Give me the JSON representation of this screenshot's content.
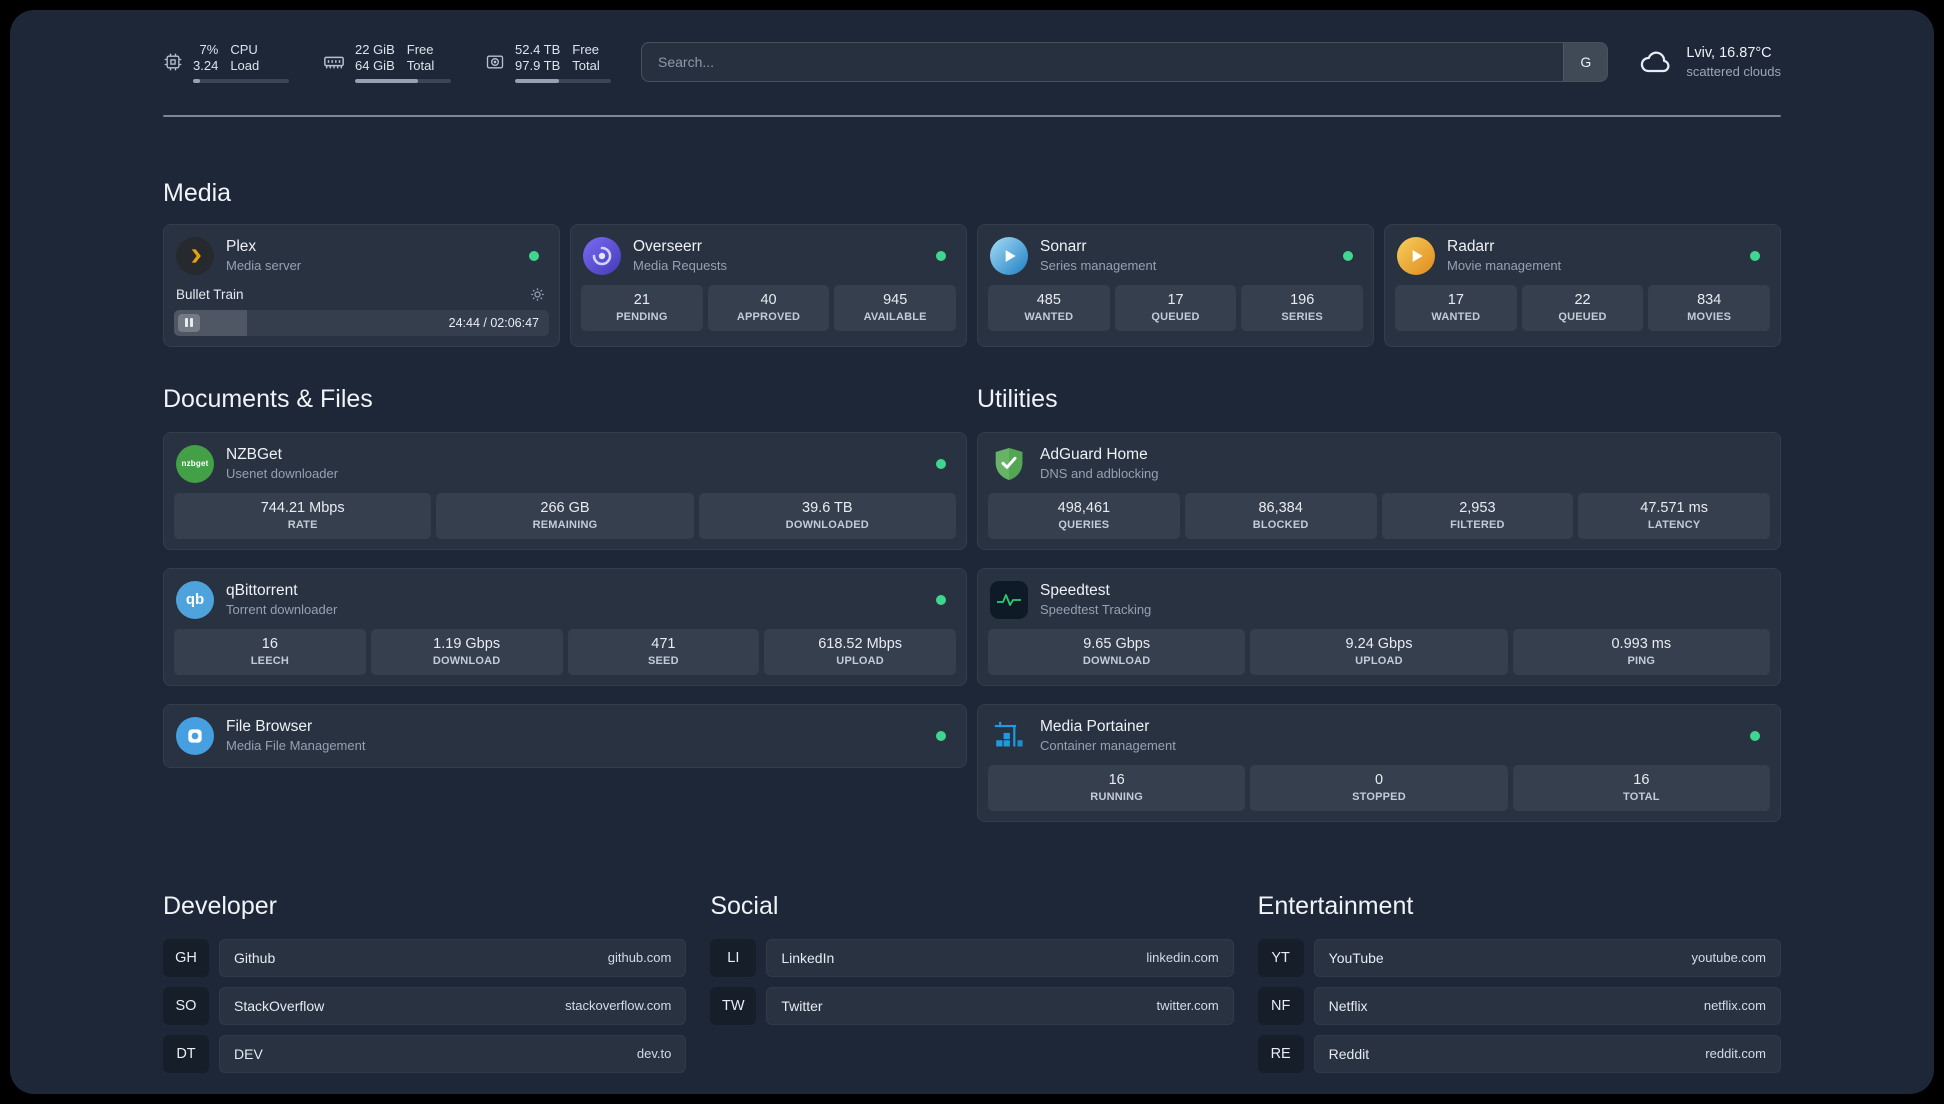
{
  "colors": {
    "page_bg": "#1d2737",
    "status_online": "#3fd68f",
    "plex_amber": "#e5a00d",
    "adguard_green": "#67b367",
    "speedtest_green": "#2ecc71",
    "portainer_blue": "#1f9ce0",
    "nzbget_green": "#43a047",
    "qbittorrent_blue": "#4fa3dc"
  },
  "icons": {
    "topbar": [
      "cpu-icon",
      "memory-icon",
      "disk-icon"
    ],
    "weather": "cloud-icon",
    "search_provider": "google-button",
    "plex_row": [
      "pause-icon",
      "gear-icon"
    ],
    "status": "online-dot"
  },
  "topbar": {
    "resources": [
      {
        "rows": [
          {
            "value": "7%",
            "label": "CPU"
          },
          {
            "value": "3.24",
            "label": "Load"
          }
        ],
        "used_percent": 7
      },
      {
        "rows": [
          {
            "value": "22 GiB",
            "label": "Free"
          },
          {
            "value": "64 GiB",
            "label": "Total"
          }
        ],
        "used_percent": 66
      },
      {
        "rows": [
          {
            "value": "52.4 TB",
            "label": "Free"
          },
          {
            "value": "97.9 TB",
            "label": "Total"
          }
        ],
        "used_percent": 46
      }
    ],
    "search": {
      "placeholder": "Search...",
      "provider_button": "G"
    },
    "weather": {
      "location": "Lviv, 16.87°C",
      "condition": "scattered clouds"
    }
  },
  "sections": {
    "media": {
      "title": "Media"
    },
    "documents": {
      "title": "Documents & Files"
    },
    "utilities": {
      "title": "Utilities"
    }
  },
  "services": {
    "plex": {
      "name": "Plex",
      "desc": "Media server",
      "now_playing": {
        "title": "Bullet Train",
        "time": "24:44 / 02:06:47",
        "progress_percent": 19.5
      }
    },
    "overseerr": {
      "name": "Overseerr",
      "desc": "Media Requests",
      "stats": [
        {
          "value": "21",
          "label": "PENDING"
        },
        {
          "value": "40",
          "label": "APPROVED"
        },
        {
          "value": "945",
          "label": "AVAILABLE"
        }
      ]
    },
    "sonarr": {
      "name": "Sonarr",
      "desc": "Series management",
      "stats": [
        {
          "value": "485",
          "label": "WANTED"
        },
        {
          "value": "17",
          "label": "QUEUED"
        },
        {
          "value": "196",
          "label": "SERIES"
        }
      ]
    },
    "radarr": {
      "name": "Radarr",
      "desc": "Movie management",
      "stats": [
        {
          "value": "17",
          "label": "WANTED"
        },
        {
          "value": "22",
          "label": "QUEUED"
        },
        {
          "value": "834",
          "label": "MOVIES"
        }
      ]
    },
    "nzbget": {
      "name": "NZBGet",
      "desc": "Usenet downloader",
      "icon_text": "nzbget",
      "stats": [
        {
          "value": "744.21 Mbps",
          "label": "RATE"
        },
        {
          "value": "266 GB",
          "label": "REMAINING"
        },
        {
          "value": "39.6 TB",
          "label": "DOWNLOADED"
        }
      ]
    },
    "qbittorrent": {
      "name": "qBittorrent",
      "desc": "Torrent downloader",
      "icon_text": "qb",
      "stats": [
        {
          "value": "16",
          "label": "LEECH"
        },
        {
          "value": "1.19 Gbps",
          "label": "DOWNLOAD"
        },
        {
          "value": "471",
          "label": "SEED"
        },
        {
          "value": "618.52 Mbps",
          "label": "UPLOAD"
        }
      ]
    },
    "filebrowser": {
      "name": "File Browser",
      "desc": "Media File Management"
    },
    "adguard": {
      "name": "AdGuard Home",
      "desc": "DNS and adblocking",
      "stats": [
        {
          "value": "498,461",
          "label": "QUERIES"
        },
        {
          "value": "86,384",
          "label": "BLOCKED"
        },
        {
          "value": "2,953",
          "label": "FILTERED"
        },
        {
          "value": "47.571 ms",
          "label": "LATENCY"
        }
      ]
    },
    "speedtest": {
      "name": "Speedtest",
      "desc": "Speedtest Tracking",
      "stats": [
        {
          "value": "9.65 Gbps",
          "label": "DOWNLOAD"
        },
        {
          "value": "9.24 Gbps",
          "label": "UPLOAD"
        },
        {
          "value": "0.993 ms",
          "label": "PING"
        }
      ]
    },
    "portainer": {
      "name": "Media Portainer",
      "desc": "Container management",
      "stats": [
        {
          "value": "16",
          "label": "RUNNING"
        },
        {
          "value": "0",
          "label": "STOPPED"
        },
        {
          "value": "16",
          "label": "TOTAL"
        }
      ]
    }
  },
  "bookmarks": [
    {
      "title": "Developer",
      "items": [
        {
          "abbr": "GH",
          "name": "Github",
          "url": "github.com"
        },
        {
          "abbr": "SO",
          "name": "StackOverflow",
          "url": "stackoverflow.com"
        },
        {
          "abbr": "DT",
          "name": "DEV",
          "url": "dev.to"
        }
      ]
    },
    {
      "title": "Social",
      "items": [
        {
          "abbr": "LI",
          "name": "LinkedIn",
          "url": "linkedin.com"
        },
        {
          "abbr": "TW",
          "name": "Twitter",
          "url": "twitter.com"
        }
      ]
    },
    {
      "title": "Entertainment",
      "items": [
        {
          "abbr": "YT",
          "name": "YouTube",
          "url": "youtube.com"
        },
        {
          "abbr": "NF",
          "name": "Netflix",
          "url": "netflix.com"
        },
        {
          "abbr": "RE",
          "name": "Reddit",
          "url": "reddit.com"
        }
      ]
    }
  ]
}
